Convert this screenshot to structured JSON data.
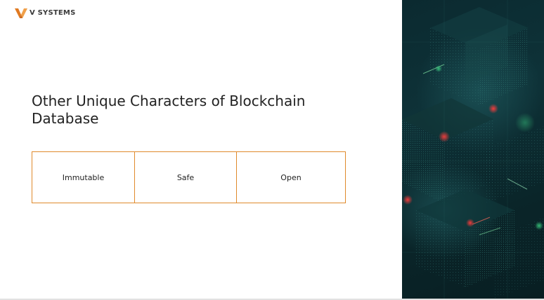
{
  "brand": {
    "name": "V SYSTEMS",
    "accent_color": "#e08a2c",
    "logo_icon": "v-systems-logo-icon"
  },
  "slide": {
    "title": "Other Unique Characters of Blockchain Database",
    "characteristics": [
      {
        "label": "Immutable"
      },
      {
        "label": "Safe"
      },
      {
        "label": "Open"
      }
    ],
    "box_border_color": "#e08a2c",
    "image_panel": {
      "icon": "blockchain-abstract-image",
      "background_color": "#0e3238"
    }
  }
}
